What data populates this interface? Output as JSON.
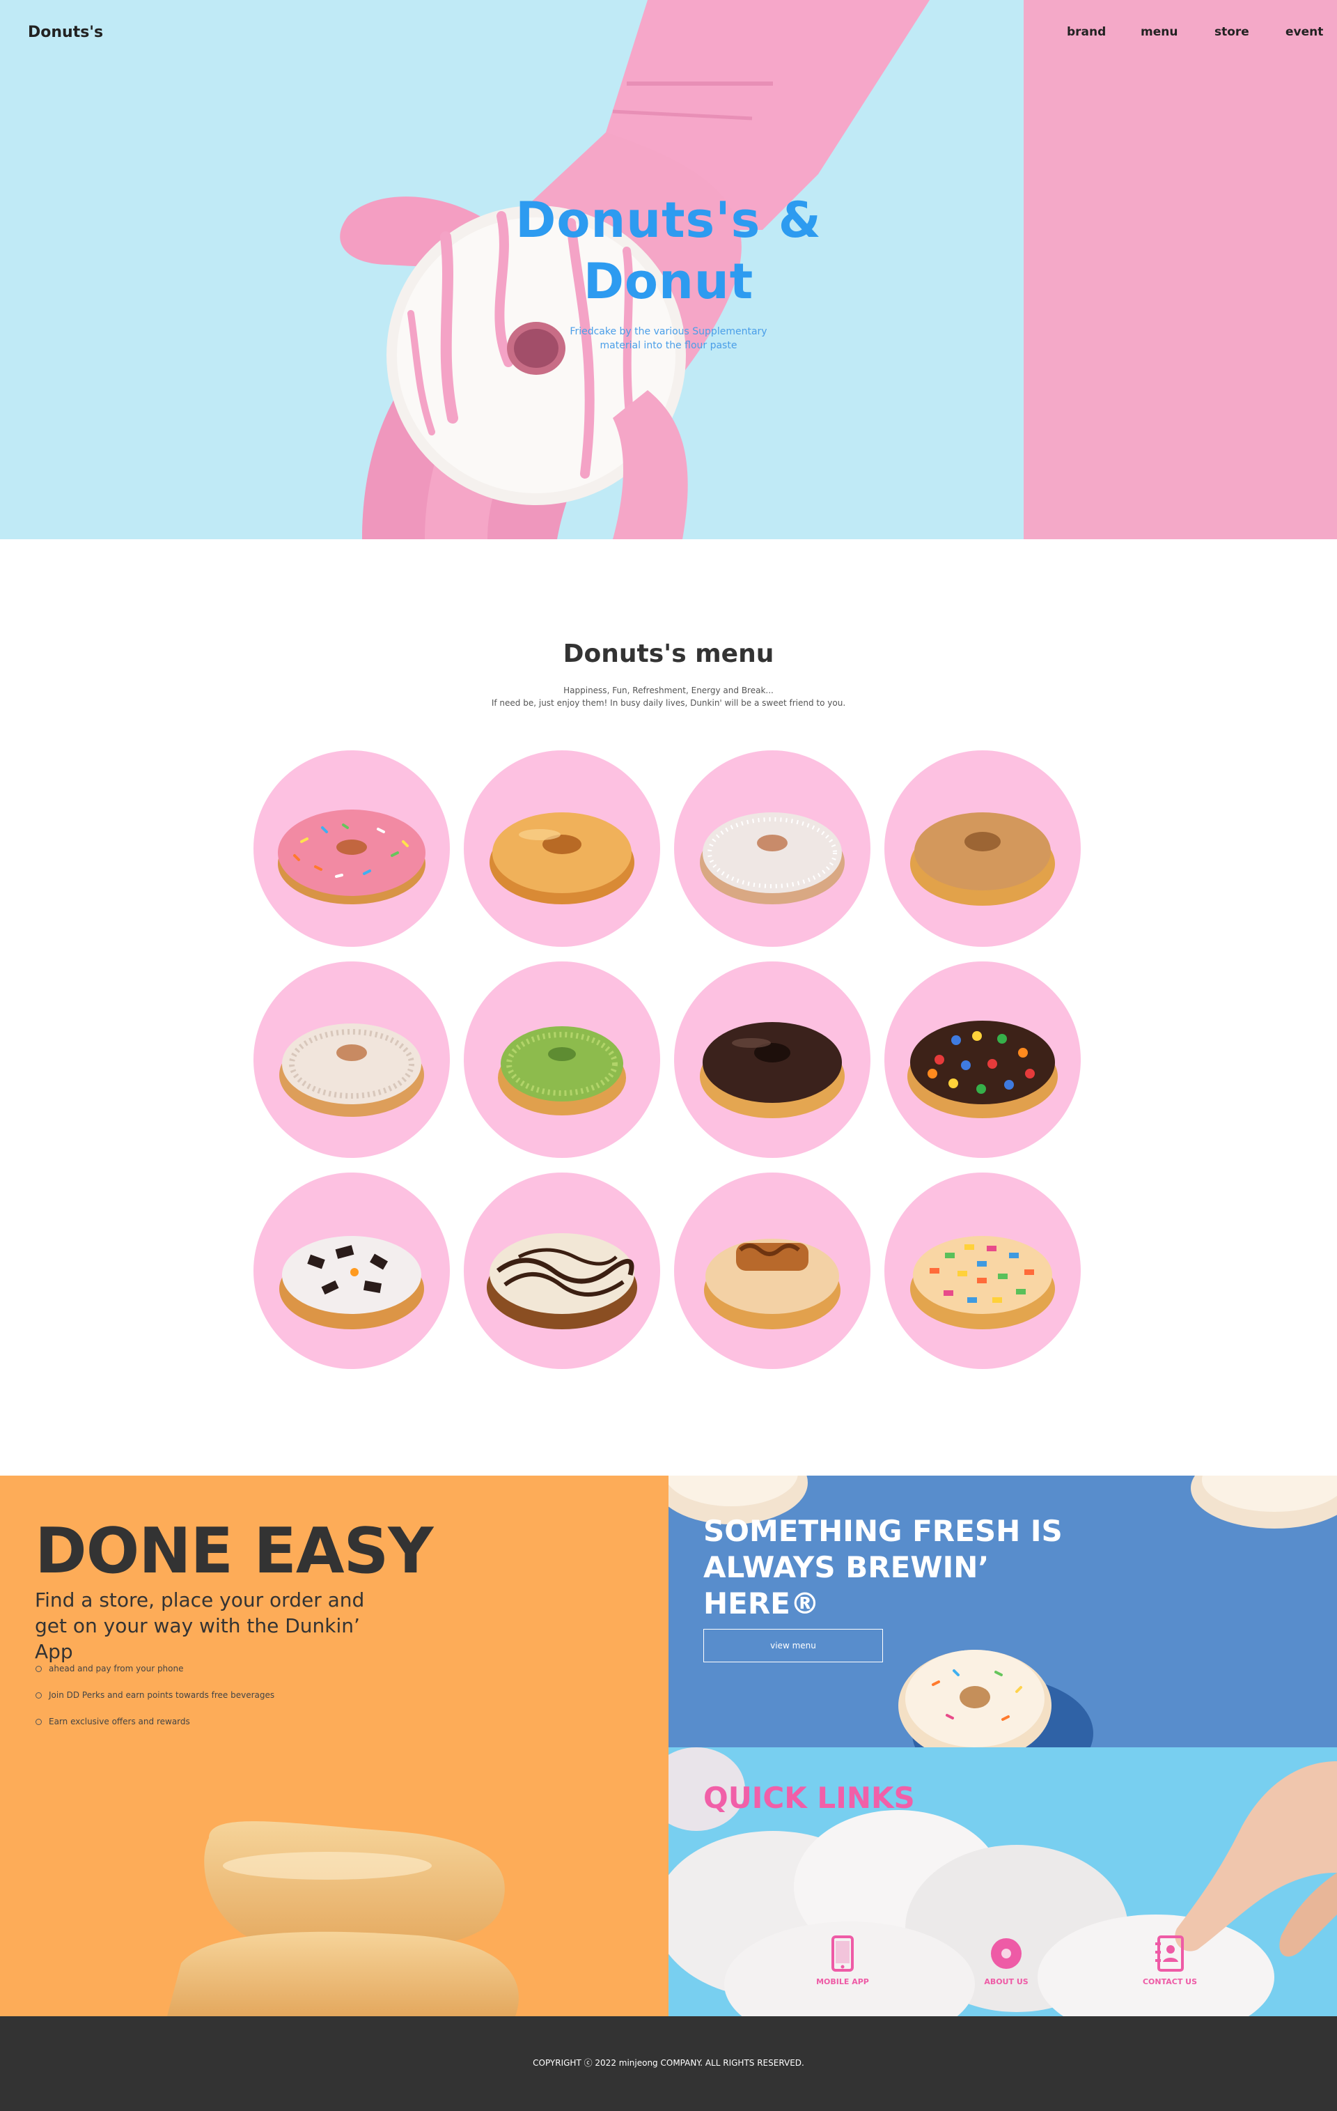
{
  "header": {
    "logo": "Donuts's",
    "nav": [
      "brand",
      "menu",
      "store",
      "event"
    ]
  },
  "hero": {
    "title_line1": "Donuts's &",
    "title_line2": "Donut",
    "subtitle_line1": "Friedcake by the various Supplementary",
    "subtitle_line2": "material into the flour paste"
  },
  "menu": {
    "title": "Donuts's menu",
    "desc_line1": "Happiness, Fun, Refreshment, Energy and Break...",
    "desc_line2": "If need be, just enjoy them! In busy daily lives, Dunkin' will be a sweet friend to you.",
    "items": [
      {
        "icon": "strawberry-sprinkle-donut-icon"
      },
      {
        "icon": "glazed-donut-icon"
      },
      {
        "icon": "sugar-donut-icon"
      },
      {
        "icon": "maple-donut-icon"
      },
      {
        "icon": "coconut-donut-icon"
      },
      {
        "icon": "pistachio-donut-icon"
      },
      {
        "icon": "chocolate-donut-icon"
      },
      {
        "icon": "candy-donut-icon"
      },
      {
        "icon": "cookie-donut-icon"
      },
      {
        "icon": "smores-donut-icon"
      },
      {
        "icon": "caramel-donut-icon"
      },
      {
        "icon": "cereal-donut-icon"
      }
    ],
    "colors": {
      "circle": "#fdc1e1",
      "dough": "#e7a24e"
    }
  },
  "easy": {
    "title": "DONE EASY",
    "subtitle_line1": "Find a store, place your order and",
    "subtitle_line2": "get on your way with the Dunkin’ App",
    "list": [
      "ahead and pay from your phone",
      "Join DD Perks and earn points towards free beverages",
      "Earn exclusive offers and rewards"
    ]
  },
  "fresh": {
    "title_line1": "SOMETHING FRESH IS",
    "title_line2": "ALWAYS BREWIN’",
    "title_line3": "HERE®",
    "button": "view menu"
  },
  "quick": {
    "title": "QUICK LINKS",
    "links": [
      {
        "label": "MOBILE APP",
        "icon": "mobile-icon"
      },
      {
        "label": "ABOUT US",
        "icon": "donut-icon"
      },
      {
        "label": "CONTACT US",
        "icon": "contact-book-icon"
      }
    ]
  },
  "footer": {
    "copyright": "COPYRIGHT ⓒ 2022 minjeong COMPANY. ALL RIGHTS RESERVED."
  },
  "colors": {
    "hero_blue": "#c0eaf6",
    "hero_pink": "#f4a9c8",
    "title_blue": "#2d9bf0",
    "orange": "#fdac58",
    "blue_panel": "#588dcc",
    "light_blue": "#78cff0",
    "quick_pink": "#f15fa8",
    "footer": "#333333"
  }
}
